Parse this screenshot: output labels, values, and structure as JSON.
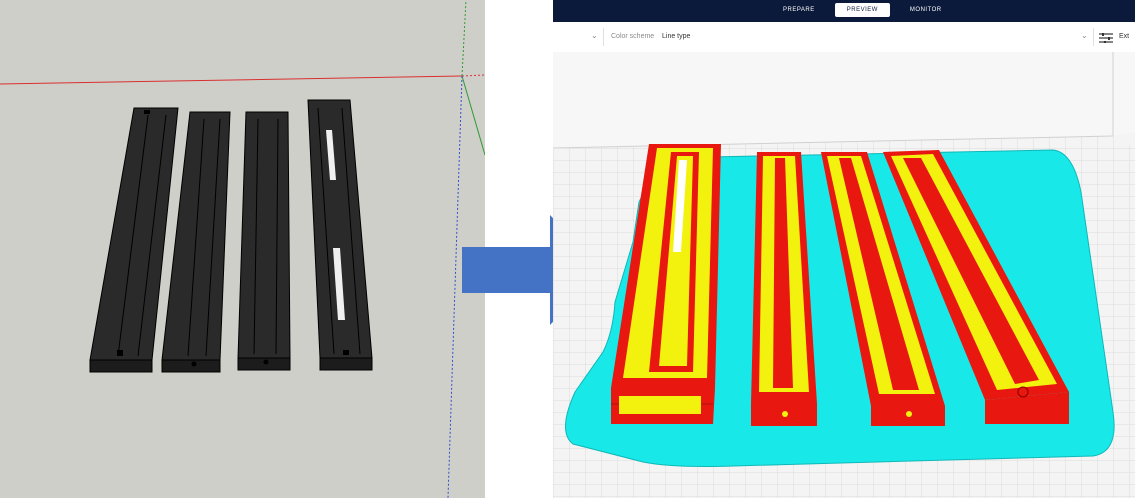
{
  "slicer": {
    "tabs": [
      {
        "label": "PREPARE",
        "active": false
      },
      {
        "label": "PREVIEW",
        "active": true
      },
      {
        "label": "MONITOR",
        "active": false
      }
    ],
    "toolbar": {
      "color_scheme_label": "Color scheme",
      "color_scheme_value": "Line type",
      "settings_text": "Ext"
    }
  },
  "colors": {
    "cad_background": "#cfcfca",
    "arrow": "#4472c4",
    "shell": "#e8170f",
    "infill": "#f3f20f",
    "skirt": "#19e8e8",
    "top_bar": "#0b1a3a"
  },
  "icons": [
    "chevron-down-icon",
    "settings-sliders-icon",
    "right-arrow-icon"
  ]
}
